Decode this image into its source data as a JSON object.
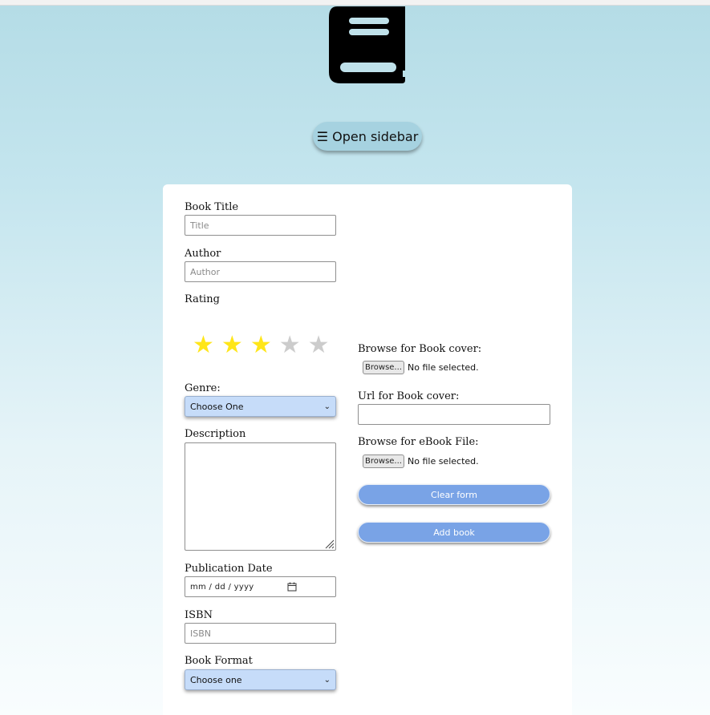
{
  "header": {
    "logo_icon": "book-icon",
    "open_sidebar_label": "☰ Open sidebar"
  },
  "form": {
    "title": {
      "label": "Book Title",
      "placeholder": "Title",
      "value": ""
    },
    "author": {
      "label": "Author",
      "placeholder": "Author",
      "value": ""
    },
    "rating": {
      "label": "Rating",
      "value": 3,
      "max": 5,
      "star_glyph": "★",
      "filled_color": "#ffe619",
      "empty_color": "#cccccc"
    },
    "genre": {
      "label": "Genre:",
      "selected": "Choose One"
    },
    "description": {
      "label": "Description",
      "value": ""
    },
    "publication_date": {
      "label": "Publication Date",
      "placeholder": "mm / dd / yyyy"
    },
    "isbn": {
      "label": "ISBN",
      "placeholder": "ISBN",
      "value": ""
    },
    "book_format": {
      "label": "Book Format",
      "selected": "Choose one"
    },
    "cover_file": {
      "label": "Browse for Book cover:",
      "button": "Browse...",
      "status": "No file selected."
    },
    "cover_url": {
      "label": "Url for Book cover:",
      "value": ""
    },
    "ebook_file": {
      "label": "Browse for eBook File:",
      "button": "Browse...",
      "status": "No file selected."
    },
    "clear_label": "Clear form",
    "add_label": "Add book"
  },
  "colors": {
    "button_accent": "#79a3e6",
    "select_bg": "#c6dcf9",
    "sidebar_button_bg": "#a6d2e0"
  }
}
